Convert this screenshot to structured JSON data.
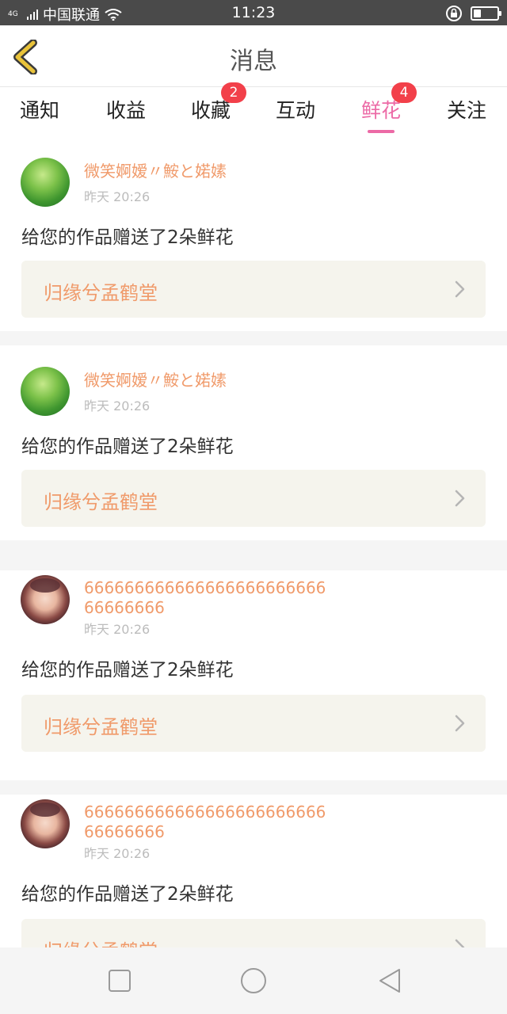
{
  "status_bar": {
    "network": "4G",
    "carrier": "中国联通",
    "time": "11:23"
  },
  "header": {
    "title": "消息"
  },
  "tabs": [
    {
      "label": "通知",
      "badge": null,
      "active": false
    },
    {
      "label": "收益",
      "badge": null,
      "active": false
    },
    {
      "label": "收藏",
      "badge": "2",
      "active": false
    },
    {
      "label": "互动",
      "badge": null,
      "active": false
    },
    {
      "label": "鲜花",
      "badge": "4",
      "active": true
    },
    {
      "label": "关注",
      "badge": null,
      "active": false
    }
  ],
  "messages": [
    {
      "user": "微笑婀嫒〃鮟と婼嫊",
      "time": "昨天 20:26",
      "text": "给您的作品赠送了2朵鲜花",
      "work": "归缘兮孟鹤堂",
      "avatar": "green"
    },
    {
      "user": "微笑婀嫒〃鮟と婼嫊",
      "time": "昨天 20:26",
      "text": "给您的作品赠送了2朵鲜花",
      "work": "归缘兮孟鹤堂",
      "avatar": "green"
    },
    {
      "user": "666666666666666666666666\n66666666",
      "time": "昨天 20:26",
      "text": "给您的作品赠送了2朵鲜花",
      "work": "归缘兮孟鹤堂",
      "avatar": "girl"
    },
    {
      "user": "666666666666666666666666\n66666666",
      "time": "昨天 20:26",
      "text": "给您的作品赠送了2朵鲜花",
      "work": "归缘兮孟鹤堂",
      "avatar": "girl"
    }
  ],
  "colors": {
    "accent": "#ec6aa6",
    "username": "#f09a6a",
    "badge": "#f2404a",
    "back_arrow": "#e9c33a"
  }
}
